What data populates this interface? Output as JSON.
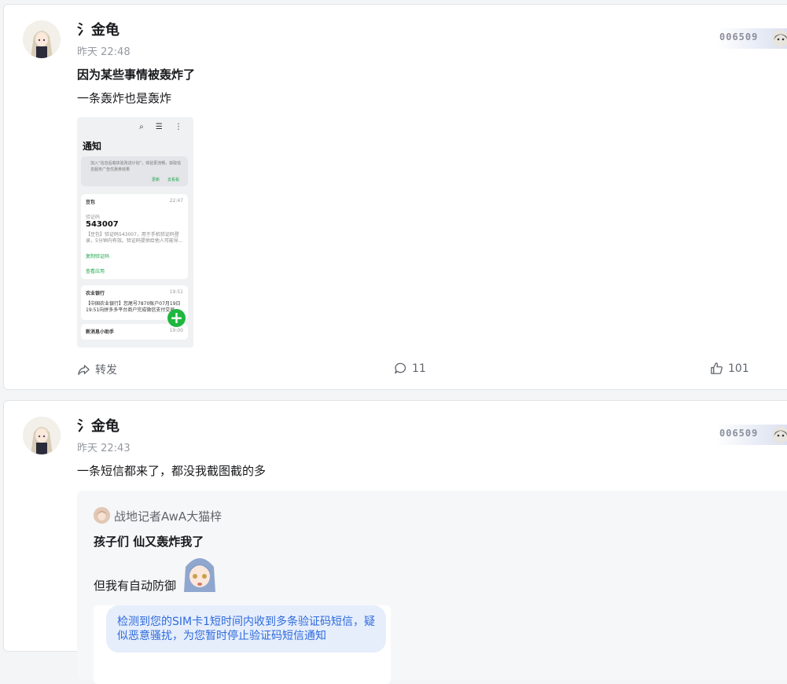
{
  "posts": [
    {
      "username": "氵金龟",
      "time": "昨天 22:48",
      "title": "因为某些事情被轰炸了",
      "text": "一条轰炸也是轰炸",
      "decor_number": "006509",
      "screenshot": {
        "title": "通知",
        "tip": "加入“信息后载体验改进计划”，体验更流畅，获取信息服务广告优惠券效果",
        "tip_link_1": "更新",
        "tip_link_2": "去看看",
        "n1_app": "豆包",
        "n1_time": "22:47",
        "n1_label": "验证码",
        "n1_code": "543007",
        "n1_body": "【豆包】验证码543007，用于手机验证码登录，5分钟内有效。验证码提供给他人可能导...",
        "n1_link": "复制验证码",
        "n1_link2": "查看应用",
        "n2_app": "农业银行",
        "n2_time": "19:51",
        "n2_body": "【中国农业银行】您尾号7870账户07月19日19:51向拼多多平台商户完成微信支付交易...",
        "n3_app": "新消息小助手",
        "n3_time": "19:00"
      },
      "actions": {
        "share": "转发",
        "comments": "11",
        "likes": "101"
      }
    },
    {
      "username": "氵金龟",
      "time": "昨天 22:43",
      "text": "一条短信都来了，都没我截图截的多",
      "decor_number": "006509",
      "repost": {
        "author": "战地记者AwA大猫梓",
        "title": "孩子们 仙又轰炸我了",
        "text": "但我有自动防御",
        "sms": "检测到您的SIM卡1短时间内收到多条验证码短信，疑似恶意骚扰，为您暂时停止验证码短信通知"
      }
    }
  ],
  "colors": {
    "accent_green": "#1fb73f",
    "link_blue": "#2f6bdc",
    "muted": "#9499a0"
  },
  "icons": [
    "share-icon",
    "comment-icon",
    "like-icon",
    "search-icon",
    "list-icon",
    "more-icon",
    "plus-icon"
  ]
}
